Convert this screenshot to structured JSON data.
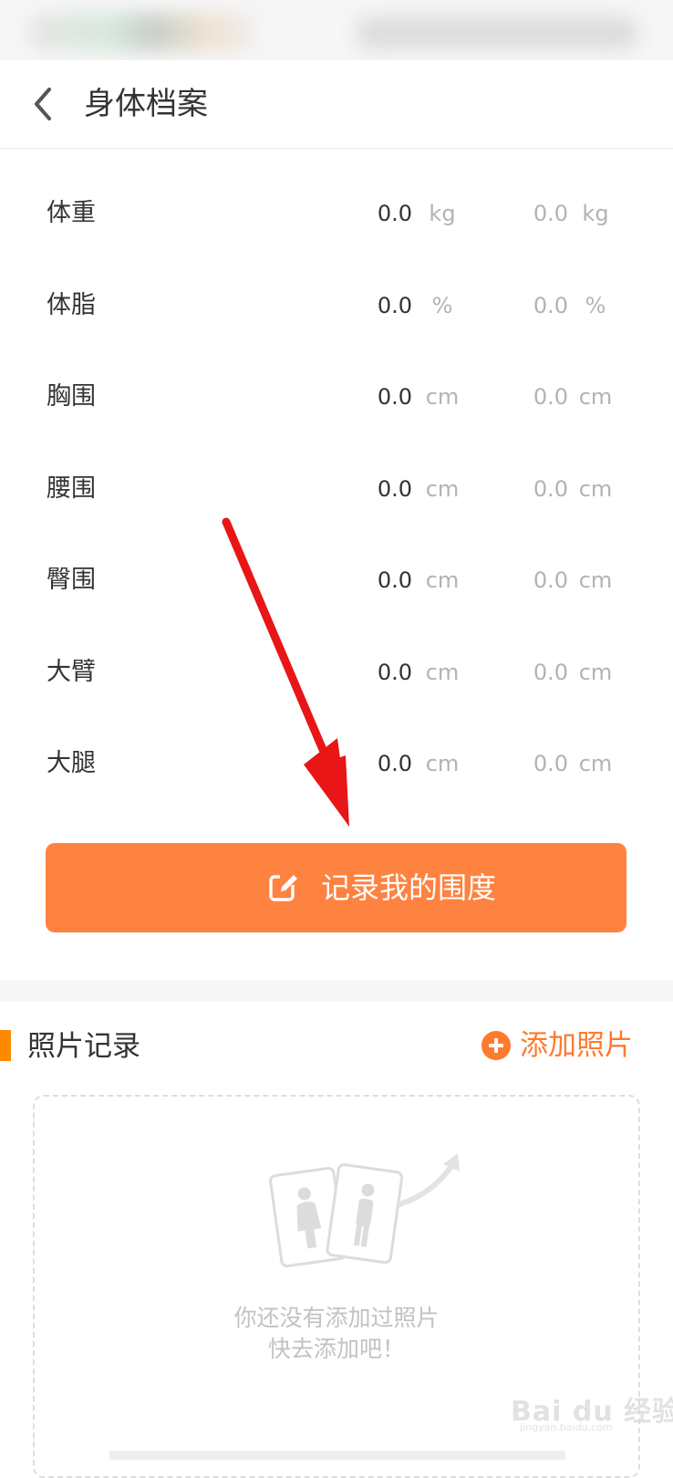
{
  "header": {
    "title": "身体档案",
    "back_icon": "chevron-left-icon"
  },
  "measurements": [
    {
      "label": "体重",
      "current_value": "0.0",
      "current_unit": "kg",
      "target_value": "0.0",
      "target_unit": "kg"
    },
    {
      "label": "体脂",
      "current_value": "0.0",
      "current_unit": "%",
      "target_value": "0.0",
      "target_unit": "%"
    },
    {
      "label": "胸围",
      "current_value": "0.0",
      "current_unit": "cm",
      "target_value": "0.0",
      "target_unit": "cm"
    },
    {
      "label": "腰围",
      "current_value": "0.0",
      "current_unit": "cm",
      "target_value": "0.0",
      "target_unit": "cm"
    },
    {
      "label": "臀围",
      "current_value": "0.0",
      "current_unit": "cm",
      "target_value": "0.0",
      "target_unit": "cm"
    },
    {
      "label": "大臂",
      "current_value": "0.0",
      "current_unit": "cm",
      "target_value": "0.0",
      "target_unit": "cm"
    },
    {
      "label": "大腿",
      "current_value": "0.0",
      "current_unit": "cm",
      "target_value": "0.0",
      "target_unit": "cm"
    }
  ],
  "record_button": {
    "label": "记录我的围度",
    "icon": "edit-icon"
  },
  "photo_section": {
    "title": "照片记录",
    "add_label": "添加照片",
    "add_icon": "plus-circle-icon",
    "empty_line1": "你还没有添加过照片",
    "empty_line2": "快去添加吧！"
  },
  "colors": {
    "accent": "#fe8240",
    "accent_text": "#fe7a2c",
    "section_marker": "#fe8a00",
    "annotation_arrow": "#e81616",
    "muted_text": "#b3b3b3"
  },
  "watermark": {
    "text": "Bai du 经验",
    "sub": "jingyan.baidu.com"
  }
}
